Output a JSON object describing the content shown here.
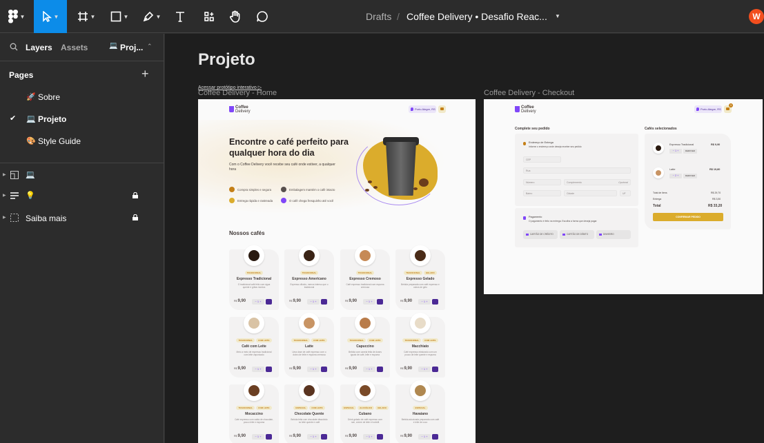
{
  "topbar": {
    "crumb_drafts": "Drafts",
    "crumb_sep": "/",
    "file_title": "Coffee Delivery • Desafio Reac...",
    "avatar_initial": "W",
    "accent": "#0c8ce9"
  },
  "left_panel": {
    "tab_layers": "Layers",
    "tab_assets": "Assets",
    "page_switch": "Proj...",
    "pages_heading": "Pages",
    "pages": [
      {
        "emoji": "🚀",
        "label": "Sobre"
      },
      {
        "emoji": "💻",
        "label": "Projeto"
      },
      {
        "emoji": "🎨",
        "label": "Style Guide"
      }
    ],
    "layers": [
      {
        "icon": "frame-icon",
        "extra": "💻",
        "label": ""
      },
      {
        "icon": "text-lines-icon",
        "extra": "💡",
        "label": ""
      },
      {
        "icon": "dashed-frame-icon",
        "extra": "",
        "label": "Saiba mais"
      }
    ]
  },
  "canvas": {
    "page_title": "Projeto",
    "prototype_link": "Acessar protótipo interativo",
    "frame_home": "Coffee Delivery - Home",
    "frame_checkout": "Coffee Delivery - Checkout"
  },
  "home": {
    "logo_line1": "Coffee",
    "logo_line2": "Delivery",
    "location": "Porto Alegre, RS",
    "hero_title": "Encontre o café perfeito para qualquer hora do dia",
    "hero_sub": "Com o Coffee Delivery você recebe seu café onde estiver, a qualquer hora",
    "features": [
      {
        "label": "Compra simples e segura",
        "color": "#c47f17"
      },
      {
        "label": "Embalagem mantém o café intacto",
        "color": "#574f4d"
      },
      {
        "label": "Entrega rápida e rastreada",
        "color": "#dbac2c"
      },
      {
        "label": "O café chega fresquinho até você",
        "color": "#8047f8"
      }
    ],
    "section_title": "Nossos cafés",
    "currency": "R$",
    "qty": "−  1  +",
    "coffees": [
      {
        "name": "Expresso Tradicional",
        "tags": [
          "TRADICIONAL"
        ],
        "desc": "O tradicional café feito com água quente e grãos moídos",
        "price": "9,90",
        "color": "#2a1a10"
      },
      {
        "name": "Expresso Americano",
        "tags": [
          "TRADICIONAL"
        ],
        "desc": "Expresso diluído, menos intenso que o tradicional",
        "price": "9,90",
        "color": "#3a2416"
      },
      {
        "name": "Expresso Cremoso",
        "tags": [
          "TRADICIONAL"
        ],
        "desc": "Café expresso tradicional com espuma cremosa",
        "price": "9,90",
        "color": "#c68a56"
      },
      {
        "name": "Expresso Gelado",
        "tags": [
          "TRADICIONAL",
          "GELADO"
        ],
        "desc": "Bebida preparada com café expresso e cubos de gelo",
        "price": "9,90",
        "color": "#4a2c18"
      },
      {
        "name": "Café com Leite",
        "tags": [
          "TRADICIONAL",
          "COM LEITE"
        ],
        "desc": "Meio a meio de expresso tradicional com leite vaporizado",
        "price": "9,90",
        "color": "#d9c3a5"
      },
      {
        "name": "Latte",
        "tags": [
          "TRADICIONAL",
          "COM LEITE"
        ],
        "desc": "Uma dose de café expresso com o dobro de leite e espuma cremosa",
        "price": "9,90",
        "color": "#c89464"
      },
      {
        "name": "Capuccino",
        "tags": [
          "TRADICIONAL",
          "COM LEITE"
        ],
        "desc": "Bebida com canela feita de doses iguais de café, leite e espuma",
        "price": "9,90",
        "color": "#b97c4a"
      },
      {
        "name": "Macchiato",
        "tags": [
          "TRADICIONAL",
          "COM LEITE"
        ],
        "desc": "Café expresso misturado com um pouco de leite quente e espuma",
        "price": "9,90",
        "color": "#e8dcc8"
      },
      {
        "name": "Mocaccino",
        "tags": [
          "TRADICIONAL",
          "COM LEITE"
        ],
        "desc": "Café expresso com calda de chocolate, pouco leite e espuma",
        "price": "9,90",
        "color": "#6b3f22"
      },
      {
        "name": "Chocolate Quente",
        "tags": [
          "ESPECIAL",
          "COM LEITE"
        ],
        "desc": "Bebida feita com chocolate dissolvido no leite quente e café",
        "price": "9,90",
        "color": "#5a3420"
      },
      {
        "name": "Cubano",
        "tags": [
          "ESPECIAL",
          "ALCOÓLICO",
          "GELADO"
        ],
        "desc": "Drink gelado de café expresso com rum, creme de leite e hortelã",
        "price": "9,90",
        "color": "#7a4a28"
      },
      {
        "name": "Havaiano",
        "tags": [
          "ESPECIAL"
        ],
        "desc": "Bebida adocicada preparada com café e leite de coco",
        "price": "9,90",
        "color": "#b08850"
      }
    ]
  },
  "checkout": {
    "left_heading": "Complete seu pedido",
    "right_heading": "Cafés selecionados",
    "address_title": "Endereço de Entrega",
    "address_sub": "Informe o endereço onde deseja receber seu pedido",
    "fields": {
      "cep": "CEP",
      "rua": "Rua",
      "numero": "Número",
      "complemento": "Complemento",
      "opcional": "Opcional",
      "bairro": "Bairro",
      "cidade": "Cidade",
      "uf": "UF"
    },
    "payment_title": "Pagamento",
    "payment_sub": "O pagamento é feito na entrega. Escolha a forma que deseja pagar",
    "payment_options": [
      "CARTÃO DE CRÉDITO",
      "CARTÃO DE DÉBITO",
      "DINHEIRO"
    ],
    "items": [
      {
        "name": "Expresso Tradicional",
        "price": "R$ 9,90",
        "qty": "−  1  +",
        "remove": "REMOVER",
        "color": "#2a1a10"
      },
      {
        "name": "Latte",
        "price": "R$ 19,80",
        "qty": "−  2  +",
        "remove": "REMOVER",
        "color": "#c89464"
      }
    ],
    "total_items_label": "Total de itens",
    "total_items": "R$ 29,70",
    "delivery_label": "Entrega",
    "delivery": "R$ 3,50",
    "total_label": "Total",
    "total": "R$ 33,20",
    "confirm": "CONFIRMAR PEDIDO",
    "cart_badge": "3"
  }
}
